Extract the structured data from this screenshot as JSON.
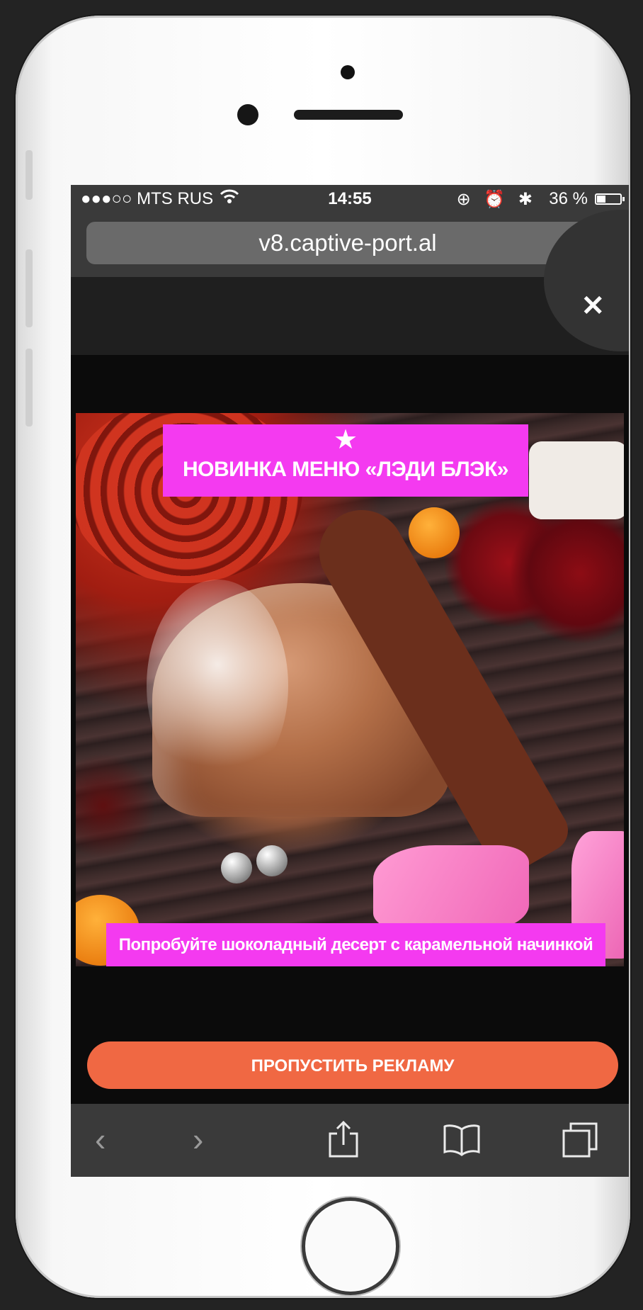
{
  "status_bar": {
    "carrier": "●●●○○ MTS RUS",
    "wifi_icon": "wifi-icon",
    "time": "14:55",
    "status_icons": "⊕ ⏰ ✱",
    "battery": "36 %",
    "battery_level": 0.36
  },
  "address_bar": {
    "url": "v8.captive-port.al",
    "reload_icon": "↻"
  },
  "ad": {
    "close_label": "✕",
    "headline_star": "★",
    "headline": "НОВИНКА МЕНЮ «ЛЭДИ БЛЭК»",
    "caption": "Попробуйте шоколадный десерт с карамельной начинкой",
    "skip_button": "ПРОПУСТИТЬ РЕКЛАМУ"
  },
  "toolbar": {
    "back": "‹",
    "forward": "›",
    "share": "⇪",
    "bookmarks": "📖",
    "tabs": "❐"
  },
  "colors": {
    "accent_magenta": "#f43af0",
    "skip_button": "#f06843",
    "browser_chrome": "#3a3a3a"
  }
}
